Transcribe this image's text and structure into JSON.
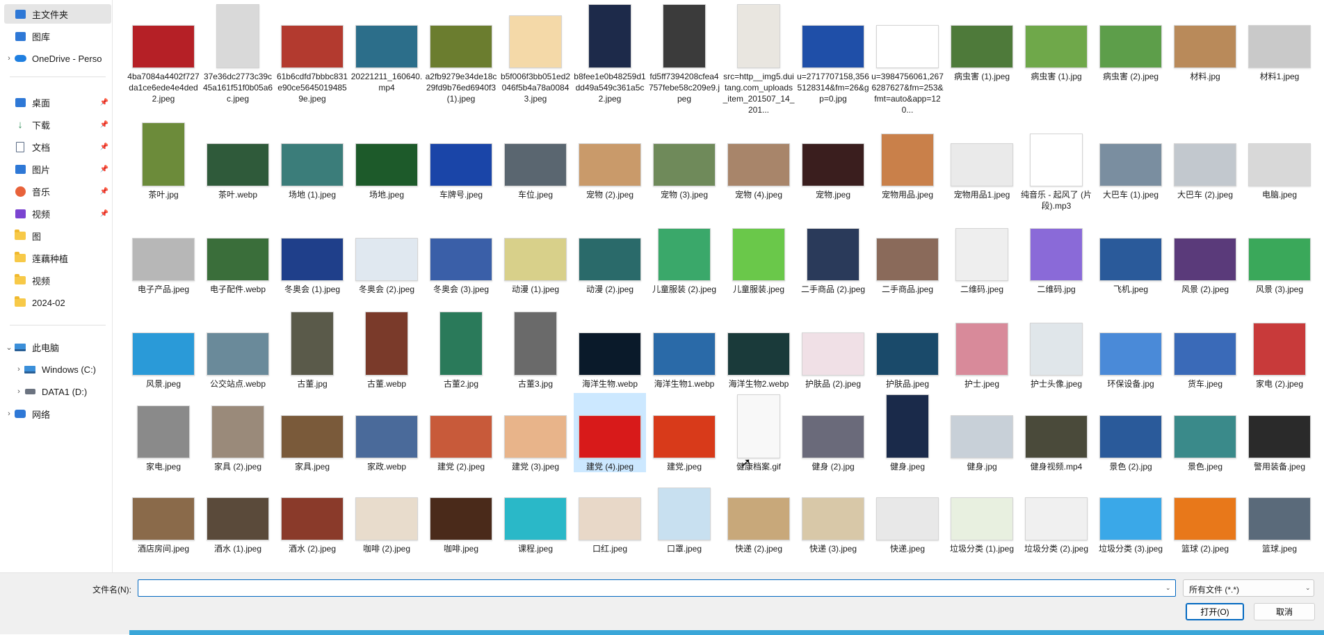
{
  "sidebar": {
    "items": [
      {
        "label": "主文件夹",
        "icon": "home-icon",
        "selected": true
      },
      {
        "label": "图库",
        "icon": "gallery-icon"
      },
      {
        "label": "OneDrive - Perso",
        "icon": "cloud-icon",
        "chevron": "›"
      },
      {
        "label": "桌面",
        "icon": "desktop-icon",
        "pin": "📌"
      },
      {
        "label": "下载",
        "icon": "download-icon",
        "pin": "📌"
      },
      {
        "label": "文档",
        "icon": "document-icon",
        "pin": "📌"
      },
      {
        "label": "图片",
        "icon": "pictures-icon",
        "pin": "📌"
      },
      {
        "label": "音乐",
        "icon": "music-icon",
        "pin": "📌"
      },
      {
        "label": "视频",
        "icon": "video-icon",
        "pin": "📌"
      },
      {
        "label": "图",
        "icon": "folder-icon"
      },
      {
        "label": "莲藕种植",
        "icon": "folder-icon"
      },
      {
        "label": "视频",
        "icon": "folder-icon"
      },
      {
        "label": "2024-02",
        "icon": "folder-icon"
      },
      {
        "label": "此电脑",
        "icon": "computer-icon",
        "chevron": "⌄"
      },
      {
        "label": "Windows (C:)",
        "icon": "windows-drive-icon",
        "chevron": "›"
      },
      {
        "label": "DATA1 (D:)",
        "icon": "drive-icon",
        "chevron": "›"
      },
      {
        "label": "网络",
        "icon": "network-icon",
        "chevron": "›"
      }
    ]
  },
  "files": [
    {
      "name": "4ba7084a4402f727da1ce6ede4e4ded2.jpeg",
      "color": "#b52026"
    },
    {
      "name": "37e36dc2773c39c45a161f51f0b05a6c.jpeg",
      "color": "#d9d9d9",
      "shape": "tall"
    },
    {
      "name": "61b6cdfd7bbbc831e90ce56450194859e.jpeg",
      "color": "#b33a2f"
    },
    {
      "name": "20221211_160640.mp4",
      "color": "#2c6e8a"
    },
    {
      "name": "a2fb9279e34de18c29fd9b76ed6940f3(1).jpeg",
      "color": "#6b7d2f"
    },
    {
      "name": "b5f006f3bb051ed2046f5b4a78a00843.jpeg",
      "color": "#f4d9a8",
      "shape": "square"
    },
    {
      "name": "b8fee1e0b48259d1dd49a549c361a5c2.jpeg",
      "color": "#1d2a4a",
      "shape": "tall"
    },
    {
      "name": "fd5ff7394208cfea4757febe58c209e9.jpeg",
      "color": "#3b3b3b",
      "shape": "tall"
    },
    {
      "name": "src=http__img5.duitang.com_uploads_item_201507_14_201...",
      "color": "#e9e6e0",
      "shape": "tall"
    },
    {
      "name": "u=2717707158,3565128314&fm=26&gp=0.jpg",
      "color": "#1f4fa8"
    },
    {
      "name": "u=3984756061,2676287627&fm=253&fmt=auto&app=120...",
      "color": "#ffffff"
    },
    {
      "name": "病虫害 (1).jpeg",
      "color": "#4e7a3a"
    },
    {
      "name": "病虫害 (1).jpg",
      "color": "#6fa84a"
    },
    {
      "name": "病虫害 (2).jpeg",
      "color": "#5d9e4a"
    },
    {
      "name": "材料.jpg",
      "color": "#b98a5a"
    },
    {
      "name": "材料1.jpeg",
      "color": "#c9c9c9"
    },
    {
      "name": "茶叶.jpg",
      "color": "#6c8b3a",
      "shape": "tall"
    },
    {
      "name": "茶叶.webp",
      "color": "#2f5a3a"
    },
    {
      "name": "场地 (1).jpeg",
      "color": "#3b7d7a"
    },
    {
      "name": "场地.jpeg",
      "color": "#1d5a2a"
    },
    {
      "name": "车牌号.jpeg",
      "color": "#1a45a8"
    },
    {
      "name": "车位.jpeg",
      "color": "#5a6670"
    },
    {
      "name": "宠物 (2).jpeg",
      "color": "#c99a6a"
    },
    {
      "name": "宠物 (3).jpeg",
      "color": "#6f8a5a"
    },
    {
      "name": "宠物 (4).jpeg",
      "color": "#a8856a"
    },
    {
      "name": "宠物.jpeg",
      "color": "#3a1e1e"
    },
    {
      "name": "宠物用品.jpeg",
      "color": "#c9804a",
      "shape": "square"
    },
    {
      "name": "宠物用品1.jpeg",
      "color": "#eaeaea"
    },
    {
      "name": "纯音乐 - 起风了 (片段).mp3",
      "color": "#ffffff",
      "shape": "square"
    },
    {
      "name": "大巴车 (1).jpeg",
      "color": "#7a8ea0"
    },
    {
      "name": "大巴车 (2).jpeg",
      "color": "#c2c8ce"
    },
    {
      "name": "电脑.jpeg",
      "color": "#d8d8d8"
    },
    {
      "name": "电子产品.jpeg",
      "color": "#b7b7b7"
    },
    {
      "name": "电子配件.webp",
      "color": "#3a6e3a"
    },
    {
      "name": "冬奥会 (1).jpeg",
      "color": "#1f3f8a"
    },
    {
      "name": "冬奥会 (2).jpeg",
      "color": "#e0e8f0"
    },
    {
      "name": "冬奥会 (3).jpeg",
      "color": "#3a5fa8"
    },
    {
      "name": "动漫 (1).jpeg",
      "color": "#d8d08a"
    },
    {
      "name": "动漫 (2).jpeg",
      "color": "#2a6a6a"
    },
    {
      "name": "儿童服装 (2).jpeg",
      "color": "#3aa86a",
      "shape": "square"
    },
    {
      "name": "儿童服装.jpeg",
      "color": "#6ac84a",
      "shape": "square"
    },
    {
      "name": "二手商品 (2).jpeg",
      "color": "#2a3a5a",
      "shape": "square"
    },
    {
      "name": "二手商品.jpeg",
      "color": "#8a6a5a"
    },
    {
      "name": "二维码.jpeg",
      "color": "#eeeeee",
      "shape": "square"
    },
    {
      "name": "二维码.jpg",
      "color": "#8a6ad8",
      "shape": "square"
    },
    {
      "name": "飞机.jpeg",
      "color": "#2a5a9a"
    },
    {
      "name": "风景 (2).jpeg",
      "color": "#5a3a7a"
    },
    {
      "name": "风景 (3).jpeg",
      "color": "#3aa85a"
    },
    {
      "name": "风景.jpeg",
      "color": "#2a9ad8"
    },
    {
      "name": "公交站点.webp",
      "color": "#6a8a9a"
    },
    {
      "name": "古董.jpg",
      "color": "#5a5a4a",
      "shape": "tall"
    },
    {
      "name": "古董.webp",
      "color": "#7a3a2a",
      "shape": "tall"
    },
    {
      "name": "古董2.jpg",
      "color": "#2a7a5a",
      "shape": "tall"
    },
    {
      "name": "古董3.jpg",
      "color": "#6a6a6a",
      "shape": "tall"
    },
    {
      "name": "海洋生物.webp",
      "color": "#0a1a2a"
    },
    {
      "name": "海洋生物1.webp",
      "color": "#2a6aa8"
    },
    {
      "name": "海洋生物2.webp",
      "color": "#1a3a3a"
    },
    {
      "name": "护肤品 (2).jpeg",
      "color": "#f0e0e6"
    },
    {
      "name": "护肤品.jpeg",
      "color": "#1a4a6a"
    },
    {
      "name": "护士.jpeg",
      "color": "#d88a9a",
      "shape": "square"
    },
    {
      "name": "护士头像.jpeg",
      "color": "#e0e6ea",
      "shape": "square"
    },
    {
      "name": "环保设备.jpg",
      "color": "#4a8ad8"
    },
    {
      "name": "货车.jpeg",
      "color": "#3a6ab8"
    },
    {
      "name": "家电 (2).jpeg",
      "color": "#c83a3a",
      "shape": "square"
    },
    {
      "name": "家电.jpeg",
      "color": "#8a8a8a",
      "shape": "square"
    },
    {
      "name": "家具 (2).jpeg",
      "color": "#9a8a7a",
      "shape": "square"
    },
    {
      "name": "家具.jpeg",
      "color": "#7a5a3a"
    },
    {
      "name": "家政.webp",
      "color": "#4a6a9a"
    },
    {
      "name": "建党 (2).jpeg",
      "color": "#c85a3a"
    },
    {
      "name": "建党 (3).jpeg",
      "color": "#e8b48a"
    },
    {
      "name": "建党 (4).jpeg",
      "color": "#d81a1a",
      "selected": true
    },
    {
      "name": "建党.jpeg",
      "color": "#d83a1a"
    },
    {
      "name": "健康档案.gif",
      "color": "#f8f8f8",
      "shape": "tall"
    },
    {
      "name": "健身 (2).jpg",
      "color": "#6a6a7a"
    },
    {
      "name": "健身.jpeg",
      "color": "#1a2a4a",
      "shape": "tall"
    },
    {
      "name": "健身.jpg",
      "color": "#c8d0d8"
    },
    {
      "name": "健身视频.mp4",
      "color": "#4a4a3a"
    },
    {
      "name": "景色 (2).jpg",
      "color": "#2a5a9a"
    },
    {
      "name": "景色.jpeg",
      "color": "#3a8a8a"
    },
    {
      "name": "警用装备.jpeg",
      "color": "#2a2a2a"
    },
    {
      "name": "酒店房间.jpeg",
      "color": "#8a6a4a"
    },
    {
      "name": "酒水 (1).jpeg",
      "color": "#5a4a3a"
    },
    {
      "name": "酒水 (2).jpeg",
      "color": "#8a3a2a"
    },
    {
      "name": "咖啡 (2).jpeg",
      "color": "#e8dccc"
    },
    {
      "name": "咖啡.jpeg",
      "color": "#4a2a1a"
    },
    {
      "name": "课程.jpeg",
      "color": "#2ab8c8"
    },
    {
      "name": "口红.jpeg",
      "color": "#e8d8c8"
    },
    {
      "name": "口罩.jpeg",
      "color": "#c8e0f0",
      "shape": "square"
    },
    {
      "name": "快递 (2).jpeg",
      "color": "#c8a87a"
    },
    {
      "name": "快递 (3).jpeg",
      "color": "#d8c8a8"
    },
    {
      "name": "快递.jpeg",
      "color": "#e8e8e8"
    },
    {
      "name": "垃圾分类 (1).jpeg",
      "color": "#e8f0e0"
    },
    {
      "name": "垃圾分类 (2).jpeg",
      "color": "#f0f0f0"
    },
    {
      "name": "垃圾分类 (3).jpeg",
      "color": "#3aa8e8"
    },
    {
      "name": "篮球 (2).jpeg",
      "color": "#e8781a"
    },
    {
      "name": "篮球.jpeg",
      "color": "#5a6a7a"
    }
  ],
  "footer": {
    "filename_label": "文件名(N):",
    "filename_value": "",
    "dropdown_chevron": "⌄",
    "file_type": "所有文件 (*.*)",
    "open_button": "打开(O)",
    "cancel_button": "取消"
  },
  "colors": {
    "accent": "#0067c0",
    "selection": "#cce8ff",
    "sidebar_selected": "#e5e5e5",
    "bottom_strip": "#3aa6d8"
  }
}
